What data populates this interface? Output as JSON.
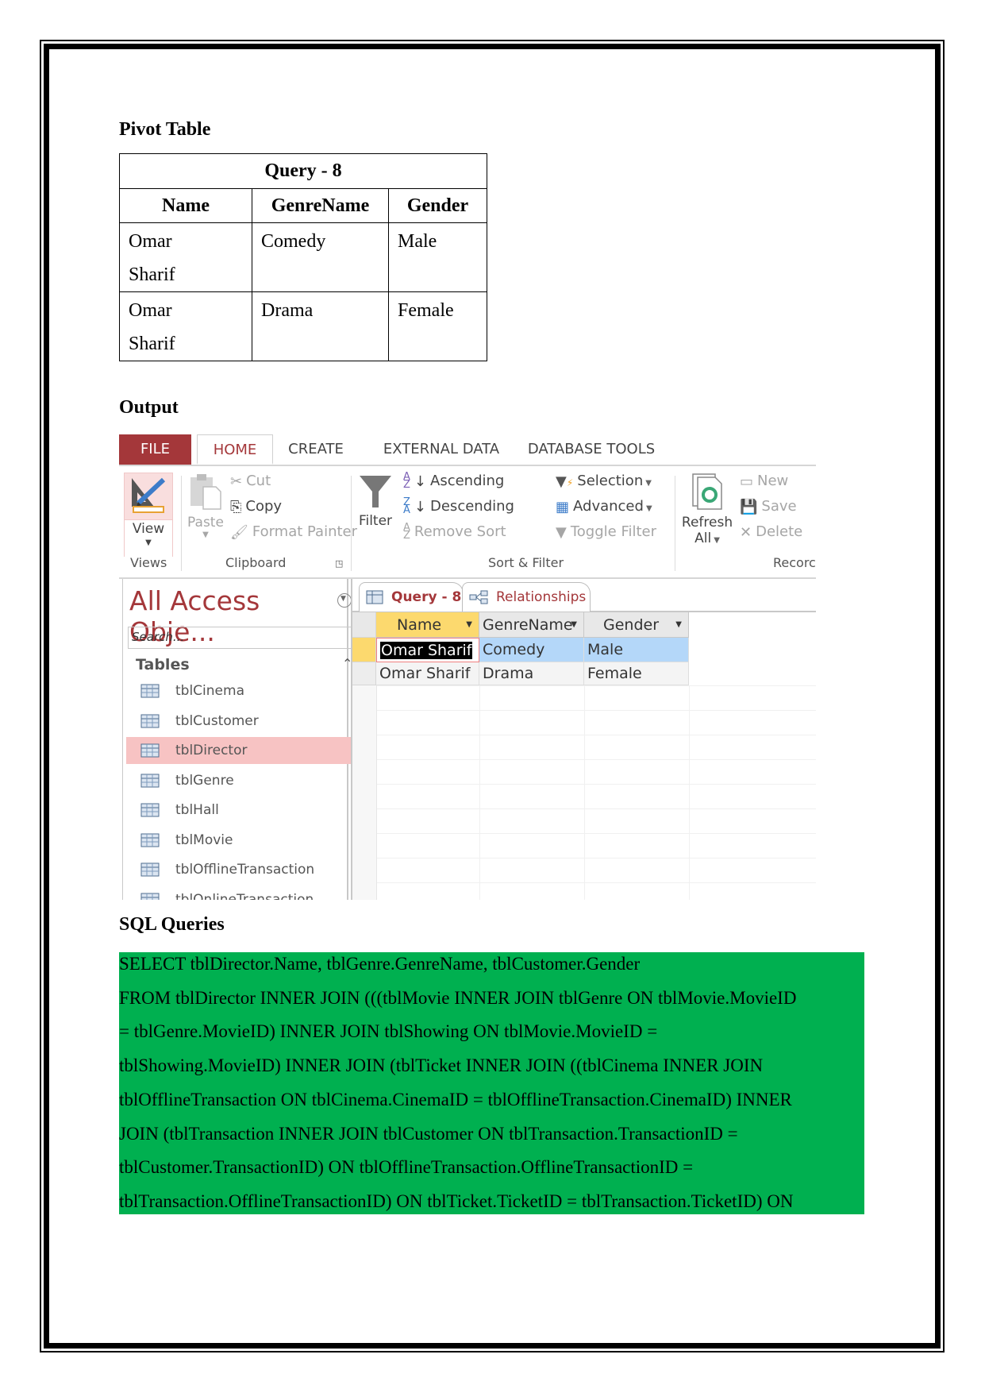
{
  "headings": {
    "pivot": "Pivot Table",
    "output": "Output",
    "sql": "SQL Queries"
  },
  "pivot_table": {
    "title": "Query - 8",
    "columns": [
      "Name",
      "GenreName",
      "Gender"
    ],
    "rows": [
      {
        "name_line1": "Omar",
        "name_line2": "Sharif",
        "genre": "Comedy",
        "gender": "Male"
      },
      {
        "name_line1": "Omar",
        "name_line2": "Sharif",
        "genre": "Drama",
        "gender": "Female"
      }
    ]
  },
  "access": {
    "ribbon_tabs": [
      "FILE",
      "HOME",
      "CREATE",
      "EXTERNAL DATA",
      "DATABASE TOOLS"
    ],
    "views": {
      "view_label": "View",
      "group": "Views"
    },
    "clipboard": {
      "paste": "Paste",
      "cut": "Cut",
      "copy": "Copy",
      "format_painter": "Format Painter",
      "group": "Clipboard"
    },
    "sort_filter": {
      "filter": "Filter",
      "ascending": "Ascending",
      "descending": "Descending",
      "remove_sort": "Remove Sort",
      "selection": "Selection",
      "advanced": "Advanced",
      "toggle_filter": "Toggle Filter",
      "group": "Sort & Filter"
    },
    "records": {
      "refresh": "Refresh",
      "refresh_all": "All",
      "new": "New",
      "save": "Save",
      "delete": "Delete",
      "group": "Recorc"
    },
    "nav_pane": {
      "title": "All Access Obje...",
      "search_placeholder": "Search...",
      "section": "Tables",
      "items": [
        "tblCinema",
        "tblCustomer",
        "tblDirector",
        "tblGenre",
        "tblHall",
        "tblMovie",
        "tblOfflineTransaction",
        "tblOnlineTransaction"
      ],
      "selected": "tblDirector"
    },
    "doc_tabs": [
      "Query - 8",
      "Relationships"
    ],
    "datasheet": {
      "columns": [
        "Name",
        "GenreName",
        "Gender"
      ],
      "rows": [
        [
          "Omar Sharif",
          "Comedy",
          "Male"
        ],
        [
          "Omar Sharif",
          "Drama",
          "Female"
        ]
      ]
    },
    "colors": {
      "accent": "#a4373a",
      "selected_nav": "#f7c3c3",
      "selected_row": "#b4d7f9",
      "active_header": "#fcd96e"
    }
  },
  "sql": {
    "background": "#00b050",
    "lines": [
      "SELECT tblDirector.Name, tblGenre.GenreName, tblCustomer.Gender",
      "FROM tblDirector INNER JOIN (((tblMovie INNER JOIN tblGenre ON tblMovie.MovieID",
      "= tblGenre.MovieID) INNER JOIN tblShowing ON tblMovie.MovieID =",
      "tblShowing.MovieID) INNER JOIN (tblTicket INNER JOIN ((tblCinema INNER JOIN",
      "tblOfflineTransaction ON tblCinema.CinemaID = tblOfflineTransaction.CinemaID) INNER",
      "JOIN (tblTransaction INNER JOIN tblCustomer ON tblTransaction.TransactionID =",
      "tblCustomer.TransactionID) ON tblOfflineTransaction.OfflineTransactionID =",
      "tblTransaction.OfflineTransactionID) ON tblTicket.TicketID = tblTransaction.TicketID) ON"
    ]
  }
}
